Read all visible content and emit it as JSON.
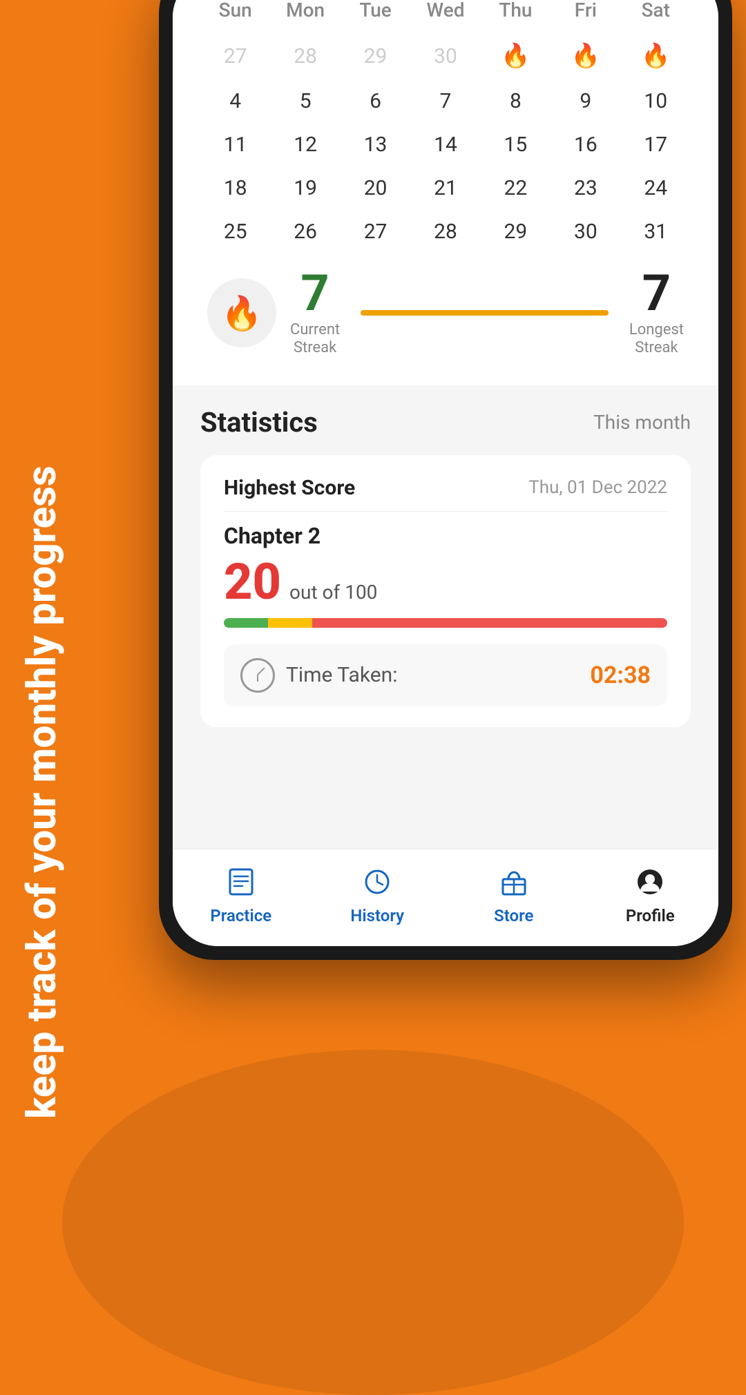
{
  "background": {
    "color": "#F07A14"
  },
  "sideText": "keep track of your monthly progress",
  "calendar": {
    "dayHeaders": [
      "Sun",
      "Mon",
      "Tue",
      "Wed",
      "Thu",
      "Fri",
      "Sat"
    ],
    "rows": [
      [
        {
          "day": "27",
          "inactive": true
        },
        {
          "day": "28",
          "inactive": true
        },
        {
          "day": "29",
          "inactive": true
        },
        {
          "day": "30",
          "inactive": true
        },
        {
          "day": "🔥",
          "fire": true
        },
        {
          "day": "🔥",
          "fire": true
        },
        {
          "day": "🔥",
          "fire": true
        }
      ],
      [
        {
          "day": "4"
        },
        {
          "day": "5"
        },
        {
          "day": "6"
        },
        {
          "day": "7"
        },
        {
          "day": "8"
        },
        {
          "day": "9"
        },
        {
          "day": "10"
        }
      ],
      [
        {
          "day": "11"
        },
        {
          "day": "12"
        },
        {
          "day": "13"
        },
        {
          "day": "14"
        },
        {
          "day": "15"
        },
        {
          "day": "16"
        },
        {
          "day": "17"
        }
      ],
      [
        {
          "day": "18"
        },
        {
          "day": "19"
        },
        {
          "day": "20"
        },
        {
          "day": "21"
        },
        {
          "day": "22"
        },
        {
          "day": "23"
        },
        {
          "day": "24"
        }
      ],
      [
        {
          "day": "25"
        },
        {
          "day": "26"
        },
        {
          "day": "27"
        },
        {
          "day": "28"
        },
        {
          "day": "29"
        },
        {
          "day": "30"
        },
        {
          "day": "31"
        }
      ]
    ]
  },
  "streak": {
    "currentStreak": "7",
    "currentStreakLabel": "Current\nStreak",
    "longestStreak": "7",
    "longestStreakLabel": "Longest\nStreak"
  },
  "statistics": {
    "title": "Statistics",
    "filter": "This month",
    "card": {
      "highestScoreLabel": "Highest Score",
      "date": "Thu, 01 Dec 2022",
      "chapterLabel": "Chapter 2",
      "score": "20",
      "outOf": "out of 100",
      "timeTakenLabel": "Time Taken:",
      "timeValue": "02:38"
    }
  },
  "nav": {
    "items": [
      {
        "label": "Practice",
        "icon": "practice-icon",
        "active": false
      },
      {
        "label": "History",
        "icon": "history-icon",
        "active": false
      },
      {
        "label": "Store",
        "icon": "store-icon",
        "active": false
      },
      {
        "label": "Profile",
        "icon": "profile-icon",
        "active": true
      }
    ]
  }
}
